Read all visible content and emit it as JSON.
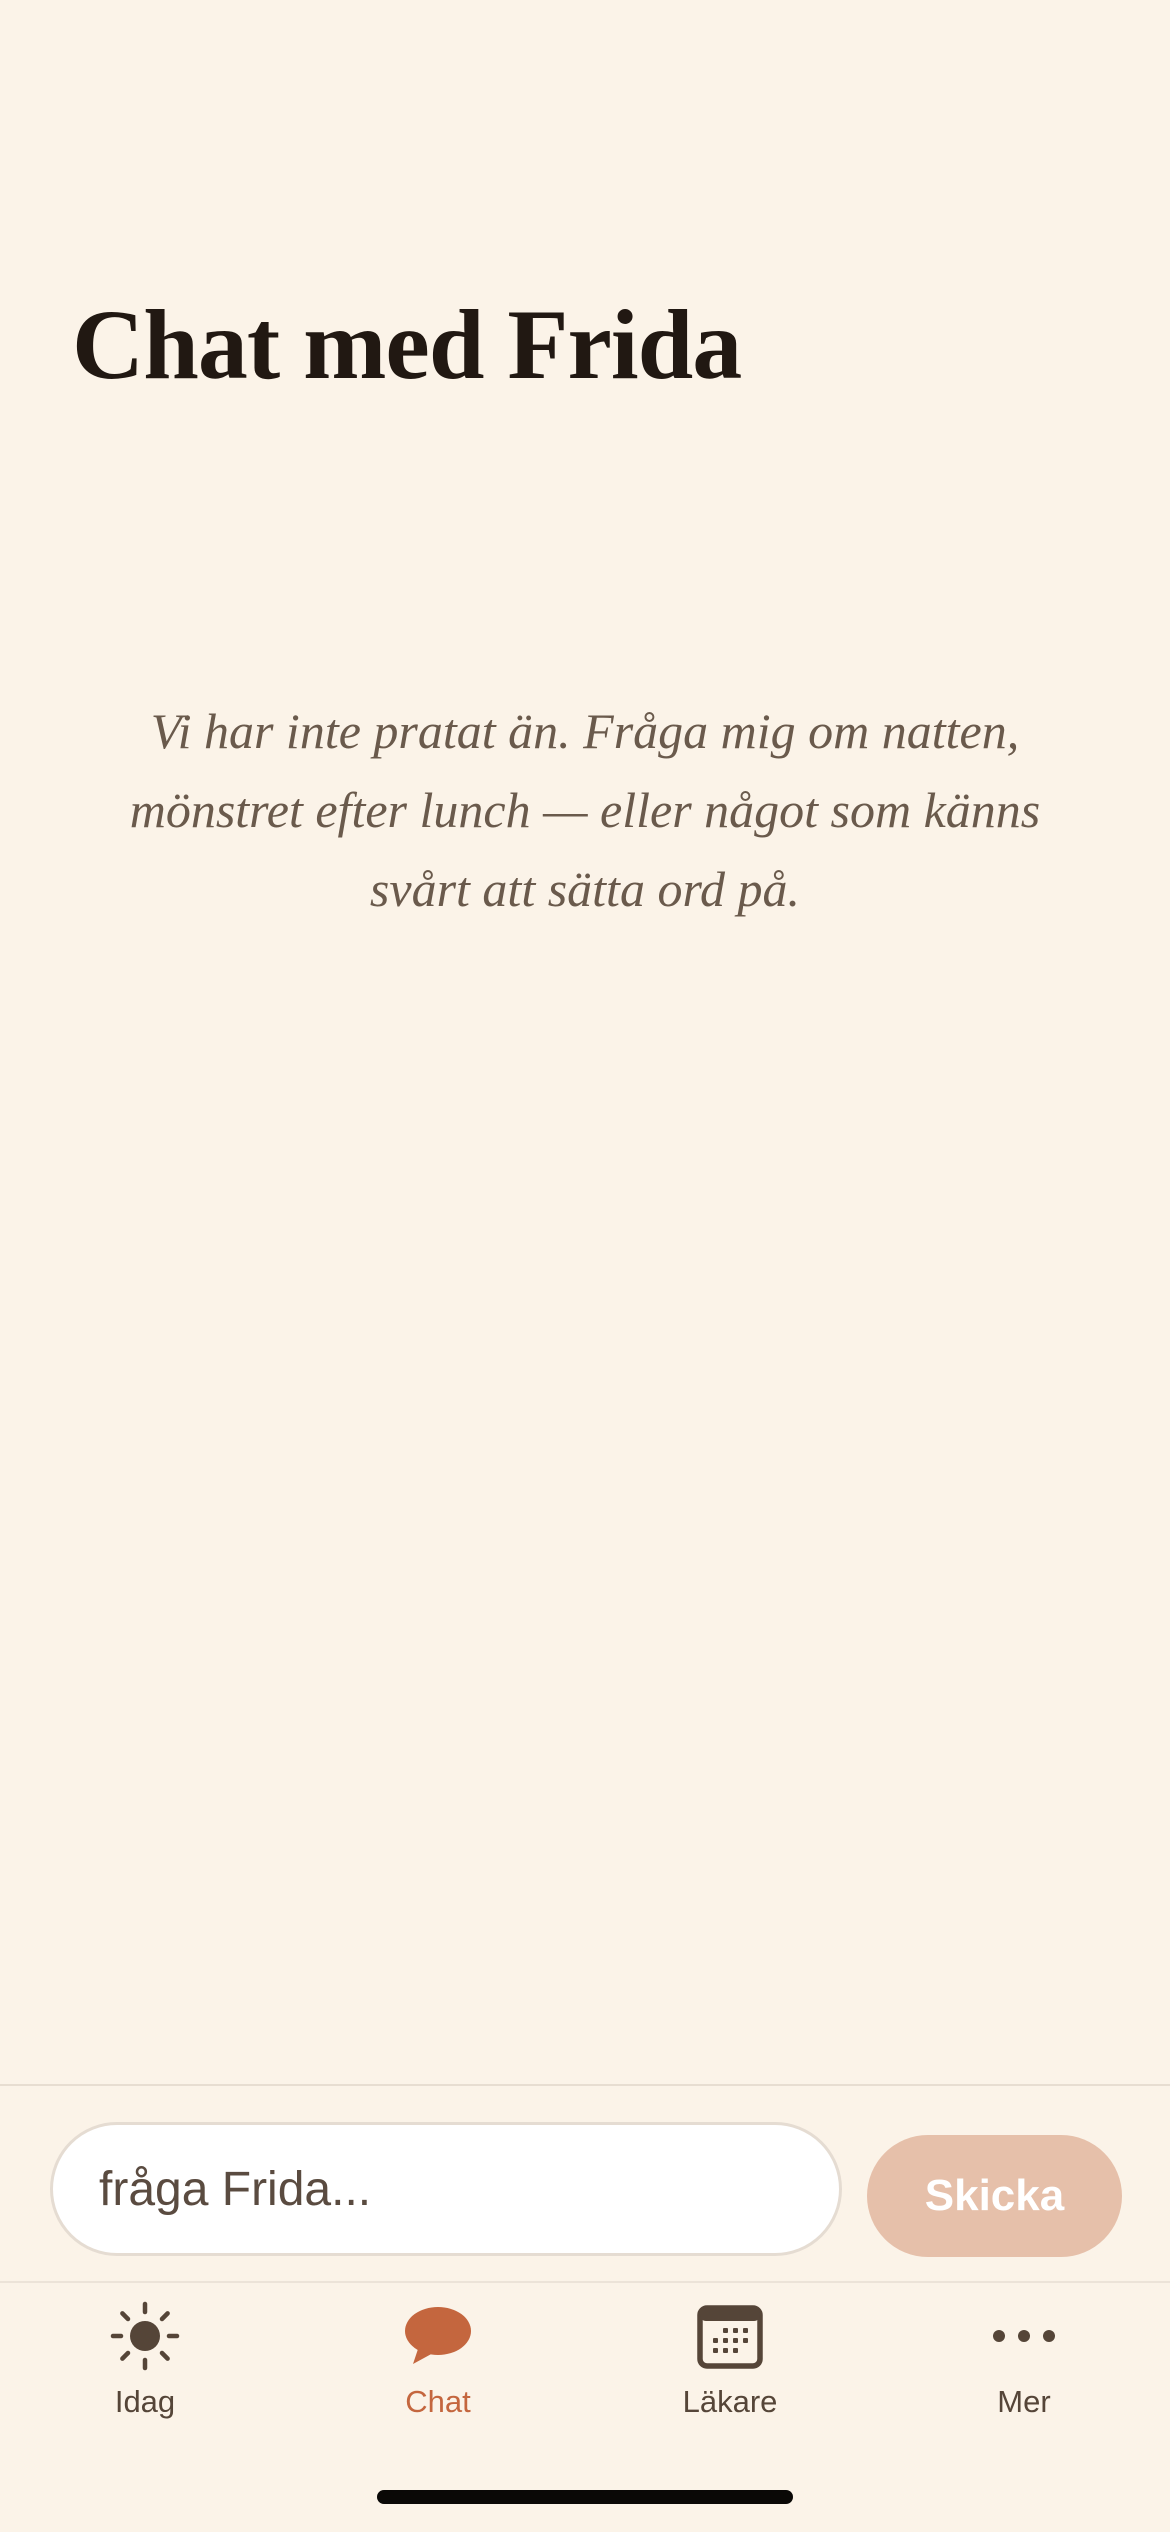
{
  "header": {
    "title": "Chat med Frida"
  },
  "chat": {
    "empty_message": "Vi har inte pratat än. Fråga mig om natten, mönstret efter lunch — eller något som känns svårt att sätta ord på."
  },
  "composer": {
    "placeholder": "fråga Frida...",
    "value": "",
    "send_label": "Skicka"
  },
  "tabbar": {
    "items": [
      {
        "label": "Idag",
        "icon": "sun-icon",
        "active": false
      },
      {
        "label": "Chat",
        "icon": "chat-bubble-icon",
        "active": true
      },
      {
        "label": "Läkare",
        "icon": "calendar-icon",
        "active": false
      },
      {
        "label": "Mer",
        "icon": "more-dots-icon",
        "active": false
      }
    ]
  },
  "colors": {
    "background": "#FBF3E8",
    "accent": "#C4663E",
    "send_button_disabled": "#E6C0AA",
    "title_text": "#211812",
    "inactive_tab": "#554538"
  }
}
